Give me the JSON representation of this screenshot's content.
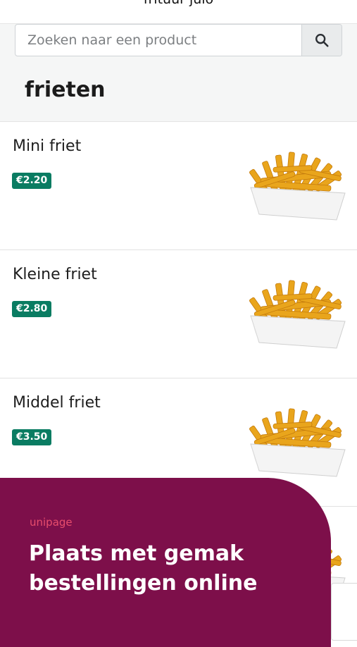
{
  "header": {
    "shop_name": "frituur julo"
  },
  "search": {
    "placeholder": "Zoeken naar een product",
    "icon": "search-icon"
  },
  "category": {
    "title": "frieten"
  },
  "products": [
    {
      "name": "Mini friet",
      "price": "€2.20"
    },
    {
      "name": "Kleine friet",
      "price": "€2.80"
    },
    {
      "name": "Middel friet",
      "price": "€3.50"
    },
    {
      "name": "",
      "price": ""
    }
  ],
  "promo": {
    "brand": "unipage",
    "headline": "Plaats met gemak bestellingen online"
  },
  "colors": {
    "price_badge": "#0a7c62",
    "promo_background": "#7d0f4a",
    "brand_accent": "#e84d6c"
  }
}
